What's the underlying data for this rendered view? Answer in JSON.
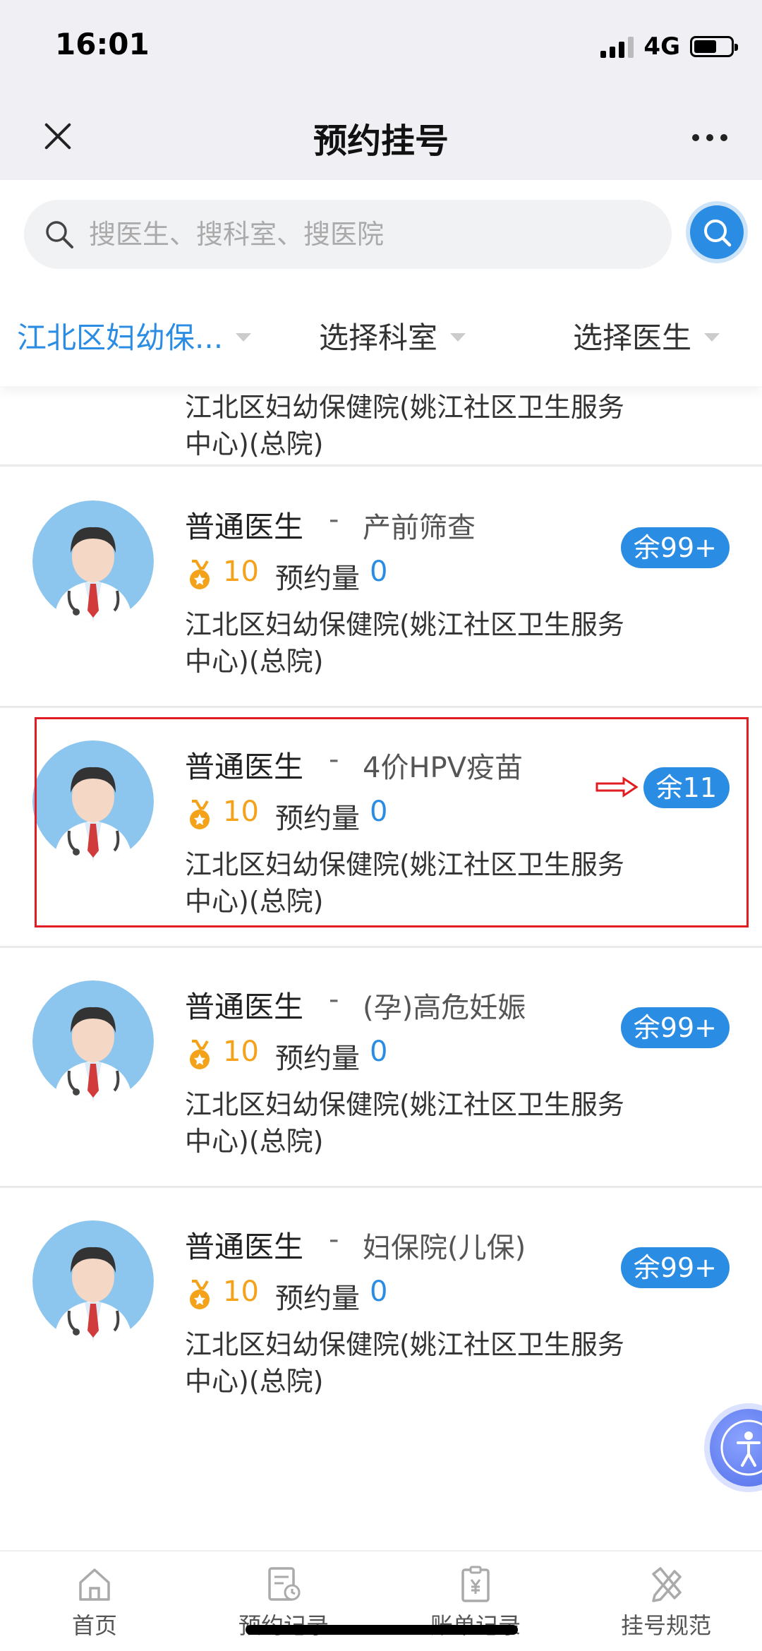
{
  "status_bar": {
    "time": "16:01",
    "network": "4G"
  },
  "nav": {
    "title": "预约挂号"
  },
  "search": {
    "placeholder": "搜医生、搜科室、搜医院"
  },
  "filters": [
    {
      "label": "江北区妇幼保..."
    },
    {
      "label": "选择科室"
    },
    {
      "label": "选择医生"
    }
  ],
  "partial_card": {
    "hospital": "江北区妇幼保健院(姚江社区卫生服务中心)(总院)"
  },
  "doctors": [
    {
      "name": "普通医生",
      "separator": "-",
      "department": "产前筛查",
      "score": "10",
      "appt_label": "预约量",
      "appt_count": "0",
      "hospital": "江北区妇幼保健院(姚江社区卫生服务中心)(总院)",
      "remaining": "余99+"
    },
    {
      "name": "普通医生",
      "separator": "-",
      "department": "4价HPV疫苗",
      "score": "10",
      "appt_label": "预约量",
      "appt_count": "0",
      "hospital": "江北区妇幼保健院(姚江社区卫生服务中心)(总院)",
      "remaining": "余11"
    },
    {
      "name": "普通医生",
      "separator": "-",
      "department": "(孕)高危妊娠",
      "score": "10",
      "appt_label": "预约量",
      "appt_count": "0",
      "hospital": "江北区妇幼保健院(姚江社区卫生服务中心)(总院)",
      "remaining": "余99+"
    },
    {
      "name": "普通医生",
      "separator": "-",
      "department": "妇保院(儿保)",
      "score": "10",
      "appt_label": "预约量",
      "appt_count": "0",
      "hospital": "江北区妇幼保健院(姚江社区卫生服务中心)(总院)",
      "remaining": "余99+"
    }
  ],
  "tabs": [
    {
      "label": "首页",
      "icon": "home-icon"
    },
    {
      "label": "预约记录",
      "icon": "appointment-record-icon"
    },
    {
      "label": "账单记录",
      "icon": "bill-record-icon"
    },
    {
      "label": "挂号规范",
      "icon": "registration-rules-icon"
    }
  ],
  "colors": {
    "accent": "#2a8de3",
    "score": "#f3a21a",
    "highlight": "#e21c23"
  }
}
